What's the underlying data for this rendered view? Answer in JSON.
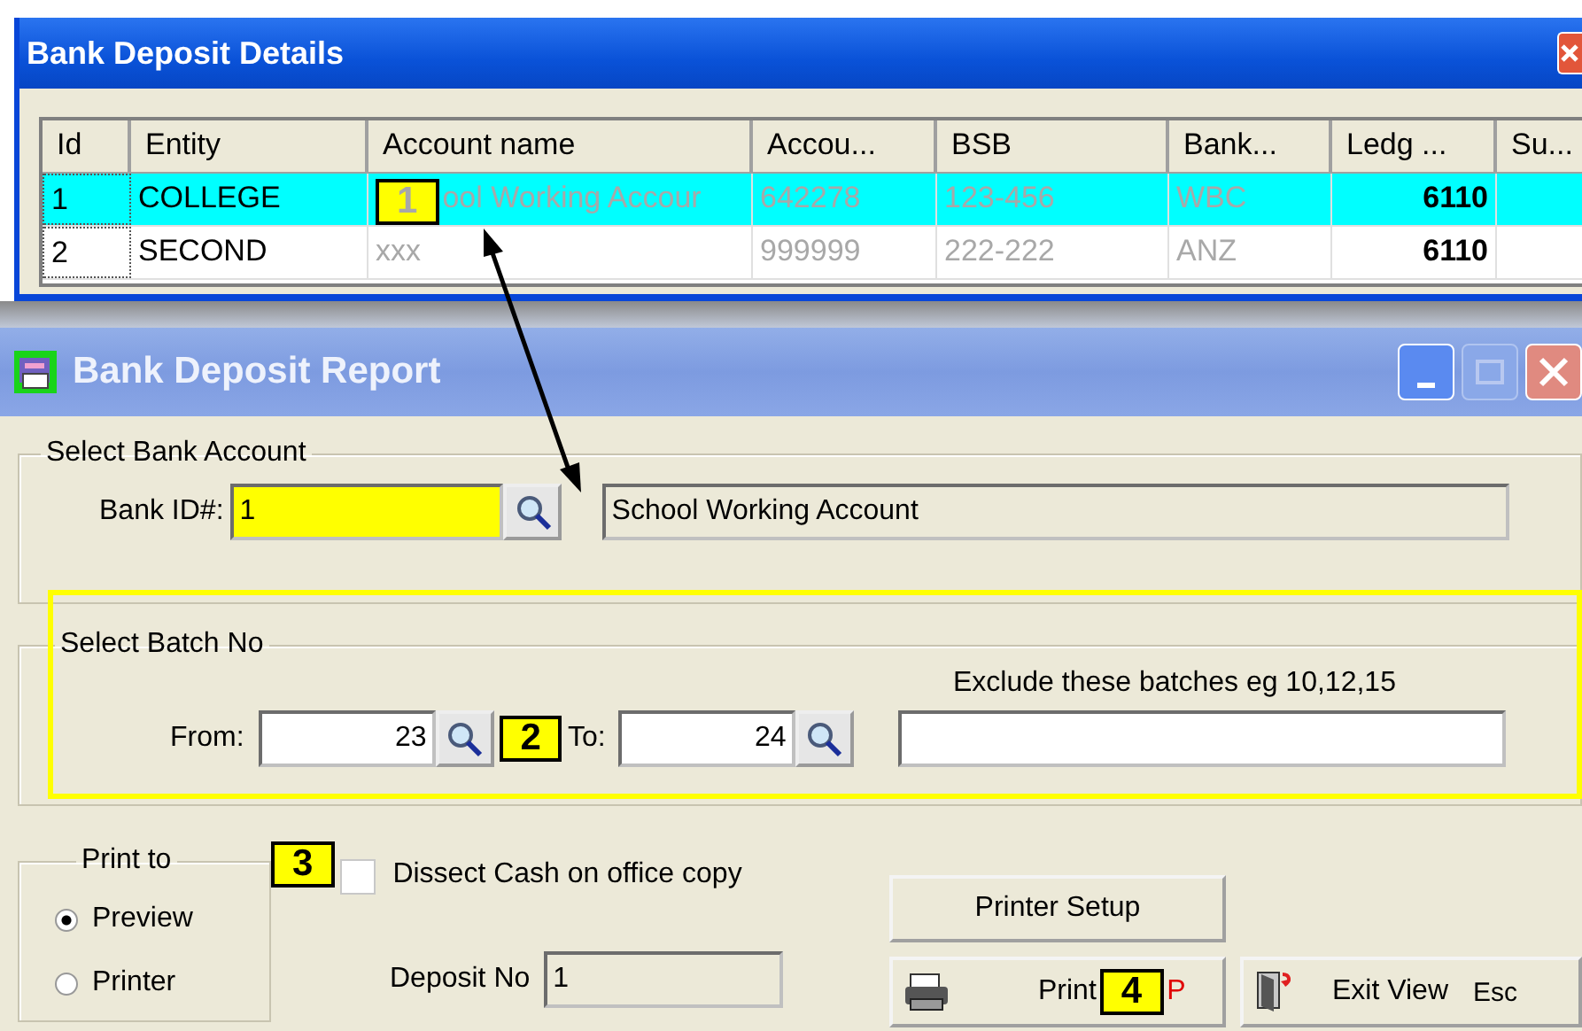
{
  "details_window": {
    "title": "Bank Deposit Details",
    "columns": [
      "Id",
      "Entity",
      "Account name",
      "Accou...",
      "BSB",
      "Bank...",
      "Ledg ...",
      "Su..."
    ],
    "rows": [
      {
        "selected": true,
        "cells": [
          "1",
          "COLLEGE",
          "ool Working Accour",
          "642278",
          "123-456",
          "WBC",
          "6110",
          ""
        ]
      },
      {
        "selected": false,
        "cells": [
          "2",
          "SECOND",
          "xxx",
          "999999",
          "222-222",
          "ANZ",
          "6110",
          ""
        ]
      }
    ]
  },
  "report_window": {
    "title": "Bank Deposit Report",
    "bank_account_group": {
      "label": "Select Bank Account",
      "bank_id_label": "Bank ID#:",
      "bank_id_value": "1",
      "account_name_value": "School Working Account"
    },
    "batch_group": {
      "label": "Select Batch No",
      "from_label": "From:",
      "from_value": "23",
      "to_label": "To:",
      "to_value": "24",
      "exclude_label": "Exclude these batches  eg 10,12,15"
    },
    "print_to": {
      "label": "Print to",
      "options": [
        {
          "label": "Preview",
          "selected": true
        },
        {
          "label": "Printer",
          "selected": false
        }
      ]
    },
    "dissect_cash": {
      "label": "Dissect Cash on office copy",
      "checked": false
    },
    "deposit_no": {
      "label": "Deposit No",
      "value": "1"
    },
    "printer_setup_button": "Printer Setup",
    "print_button": {
      "label": "Print",
      "shortcut": "P"
    },
    "exit_button": {
      "label": "Exit View",
      "shortcut": "Esc"
    }
  },
  "callouts": [
    "1",
    "2",
    "3",
    "4"
  ]
}
